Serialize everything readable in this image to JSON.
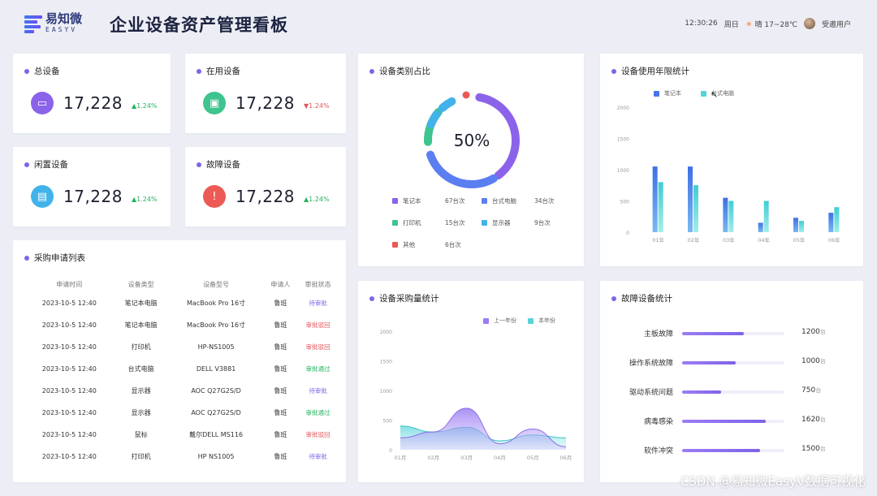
{
  "header": {
    "logo_cn": "易知微",
    "logo_en": "EASYV",
    "title": "企业设备资产管理看板",
    "time": "12:30:26",
    "weekday": "周日",
    "weather": "晴 17~28℃",
    "user": "受邀用户"
  },
  "stats": [
    {
      "label": "总设备",
      "value": "17,228",
      "change": "▲1.24%",
      "trend": "up",
      "icon": "monitor-icon",
      "color": "#8b63ea"
    },
    {
      "label": "在用设备",
      "value": "17,228",
      "change": "▼1.24%",
      "trend": "down",
      "icon": "cpu-icon",
      "color": "#3dc48f"
    },
    {
      "label": "闲置设备",
      "value": "17,228",
      "change": "▲1.24%",
      "trend": "up",
      "icon": "box-icon",
      "color": "#41b3ea"
    },
    {
      "label": "故障设备",
      "value": "17,228",
      "change": "▲1.24%",
      "trend": "up",
      "icon": "warning-icon",
      "color": "#ec5a56"
    }
  ],
  "requests": {
    "title": "采购申请列表",
    "headers": [
      "申请时间",
      "设备类型",
      "设备型号",
      "申请人",
      "审批状态"
    ],
    "rows": [
      [
        "2023-10-5 12:40",
        "笔记本电脑",
        "MacBook Pro 16寸",
        "鲁班",
        "待审批"
      ],
      [
        "2023-10-5 12:40",
        "笔记本电脑",
        "MacBook Pro 16寸",
        "鲁班",
        "审批驳回"
      ],
      [
        "2023-10-5 12:40",
        "打印机",
        "HP-NS1005",
        "鲁班",
        "审批驳回"
      ],
      [
        "2023-10-5 12:40",
        "台式电脑",
        "DELL V3881",
        "鲁班",
        "审批通过"
      ],
      [
        "2023-10-5 12:40",
        "显示器",
        "AOC Q27G2S/D",
        "鲁班",
        "待审批"
      ],
      [
        "2023-10-5 12:40",
        "显示器",
        "AOC Q27G2S/D",
        "鲁班",
        "审批通过"
      ],
      [
        "2023-10-5 12:40",
        "鼠标",
        "戴尔DELL MS116",
        "鲁班",
        "审批驳回"
      ],
      [
        "2023-10-5 12:40",
        "打印机",
        "HP NS1005",
        "鲁班",
        "待审批"
      ]
    ],
    "status_colors": {
      "待审批": "#7c66e8",
      "审批驳回": "#e2555b",
      "审批通过": "#23b35e"
    }
  },
  "category": {
    "title": "设备类别占比",
    "center_label": "50%",
    "legend": [
      {
        "name": "笔记本",
        "value": "67台次",
        "color": "#8b63ea"
      },
      {
        "name": "台式电脑",
        "value": "34台次",
        "color": "#5b7ff0"
      },
      {
        "name": "打印机",
        "value": "15台次",
        "color": "#3dc48f"
      },
      {
        "name": "显示器",
        "value": "9台次",
        "color": "#41b3ea"
      },
      {
        "name": "其他",
        "value": "6台次",
        "color": "#ec5a56"
      }
    ]
  },
  "usage": {
    "title": "设备使用年限统计",
    "legend": [
      "笔记本",
      "台式电脑"
    ]
  },
  "purchase": {
    "title": "设备采购量统计",
    "legend": [
      "上一年份",
      "本年份"
    ]
  },
  "faults": {
    "title": "故障设备统计",
    "items": [
      {
        "name": "主板故障",
        "value": "1200",
        "unit": "台",
        "ratio": 0.6
      },
      {
        "name": "操作系统故障",
        "value": "1000",
        "unit": "台",
        "ratio": 0.52
      },
      {
        "name": "驱动系统问题",
        "value": "750",
        "unit": "台",
        "ratio": 0.38
      },
      {
        "name": "病毒感染",
        "value": "1620",
        "unit": "台",
        "ratio": 0.82
      },
      {
        "name": "软件冲突",
        "value": "1500",
        "unit": "台",
        "ratio": 0.76
      }
    ]
  },
  "chart_data": [
    {
      "type": "bar",
      "title": "设备使用年限统计",
      "categories": [
        "01年",
        "02年",
        "03年",
        "04年",
        "05年",
        "06年"
      ],
      "ylim": [
        0,
        2000
      ],
      "yticks": [
        "2000",
        "1500",
        "1000",
        "500",
        "0"
      ],
      "series": [
        {
          "name": "笔记本",
          "values": [
            1050,
            1050,
            550,
            150,
            230,
            310
          ],
          "color": "#4a73e8"
        },
        {
          "name": "台式电脑",
          "values": [
            800,
            750,
            500,
            500,
            180,
            400
          ],
          "color": "#56d3d6"
        }
      ]
    },
    {
      "type": "area",
      "title": "设备采购量统计",
      "categories": [
        "01月",
        "02月",
        "03月",
        "04月",
        "05月",
        "06月"
      ],
      "ylim": [
        0,
        2000
      ],
      "yticks": [
        "2000",
        "1500",
        "1000",
        "500",
        "0"
      ],
      "series": [
        {
          "name": "上一年份",
          "values": [
            200,
            300,
            700,
            100,
            350,
            50
          ],
          "color": "#9b7df3"
        },
        {
          "name": "本年份",
          "values": [
            400,
            300,
            380,
            150,
            250,
            200
          ],
          "color": "#56d3d6"
        }
      ]
    },
    {
      "type": "pie",
      "title": "设备类别占比",
      "categories": [
        "笔记本",
        "台式电脑",
        "打印机",
        "显示器",
        "其他"
      ],
      "values": [
        67,
        34,
        15,
        9,
        6
      ]
    }
  ]
}
